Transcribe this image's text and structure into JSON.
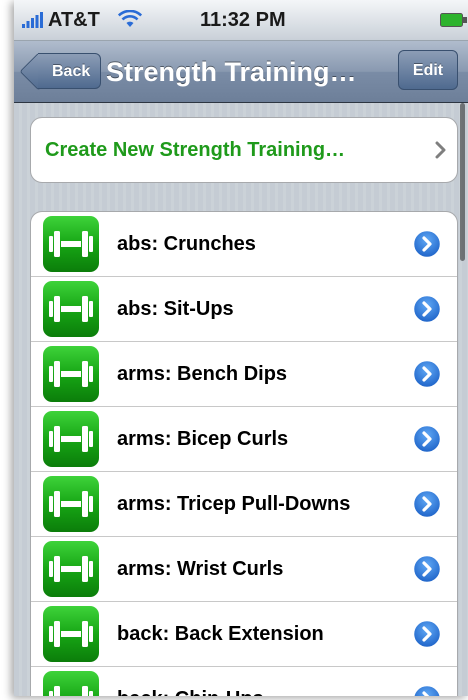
{
  "status_bar": {
    "carrier": "AT&T",
    "time": "11:32 PM",
    "icons": [
      "signal-bars-icon",
      "wifi-icon",
      "battery-icon"
    ]
  },
  "nav": {
    "back_label": "Back",
    "title": "Strength Training…",
    "edit_label": "Edit"
  },
  "create": {
    "label": "Create New Strength Training…",
    "icon": "chevron-right-icon"
  },
  "exercises": [
    {
      "label": "abs: Crunches"
    },
    {
      "label": "abs: Sit-Ups"
    },
    {
      "label": "arms: Bench Dips"
    },
    {
      "label": "arms: Bicep Curls"
    },
    {
      "label": "arms: Tricep Pull-Downs"
    },
    {
      "label": "arms: Wrist Curls"
    },
    {
      "label": "back: Back Extension"
    },
    {
      "label": "back: Chin-Ups"
    }
  ],
  "colors": {
    "accent_green": "#1f9a1b",
    "nav_blue": "#6d7f99",
    "disclosure_blue": "#2a7be0"
  }
}
